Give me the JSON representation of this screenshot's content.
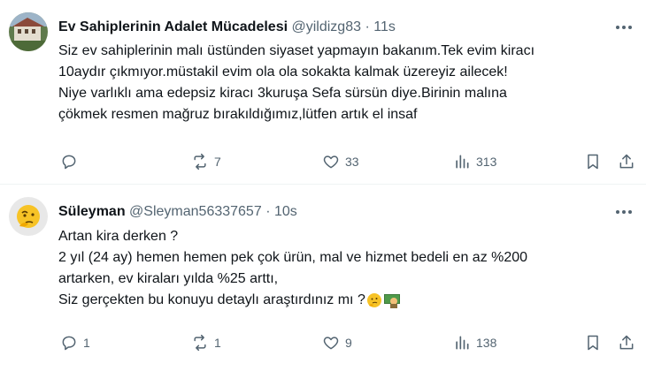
{
  "tweets": [
    {
      "name": "Ev Sahiplerinin Adalet Mücadelesi",
      "handle": "@yildizg83",
      "dot": "·",
      "time": "11s",
      "lines": [
        "Siz ev sahiplerinin malı üstünden siyaset yapmayın bakanım.Tek evim kiracı",
        "10aydır çıkmıyor.müstakil evim ola ola sokakta kalmak üzereyiz ailecek!",
        "Niye varlıklı ama edepsiz kiracı 3kuruşa Sefa sürsün diye.Birinin malına",
        "çökmek resmen mağruz bırakıldığımız,lütfen artık el insaf"
      ],
      "stats": {
        "replies": "",
        "retweets": "7",
        "likes": "33",
        "views": "313"
      }
    },
    {
      "name": "Süleyman",
      "handle": "@Sleyman56337657",
      "dot": "·",
      "time": "10s",
      "lines": [
        "Artan kira derken ?",
        "2 yıl (24 ay)  hemen hemen pek çok ürün, mal ve hizmet bedeli en az %200",
        "artarken, ev kiraları yılda %25 arttı,",
        "Siz gerçekten bu konuyu detaylı araştırdınız mı ?"
      ],
      "stats": {
        "replies": "1",
        "retweets": "1",
        "likes": "9",
        "views": "138"
      }
    }
  ],
  "icons": {
    "reply": "reply-icon",
    "retweet": "retweet-icon",
    "like": "heart-icon",
    "views": "views-icon",
    "bookmark": "bookmark-icon",
    "share": "share-icon",
    "more": "more-icon"
  },
  "colors": {
    "text": "#0f1419",
    "muted": "#536471",
    "divider": "#eff3f4"
  }
}
